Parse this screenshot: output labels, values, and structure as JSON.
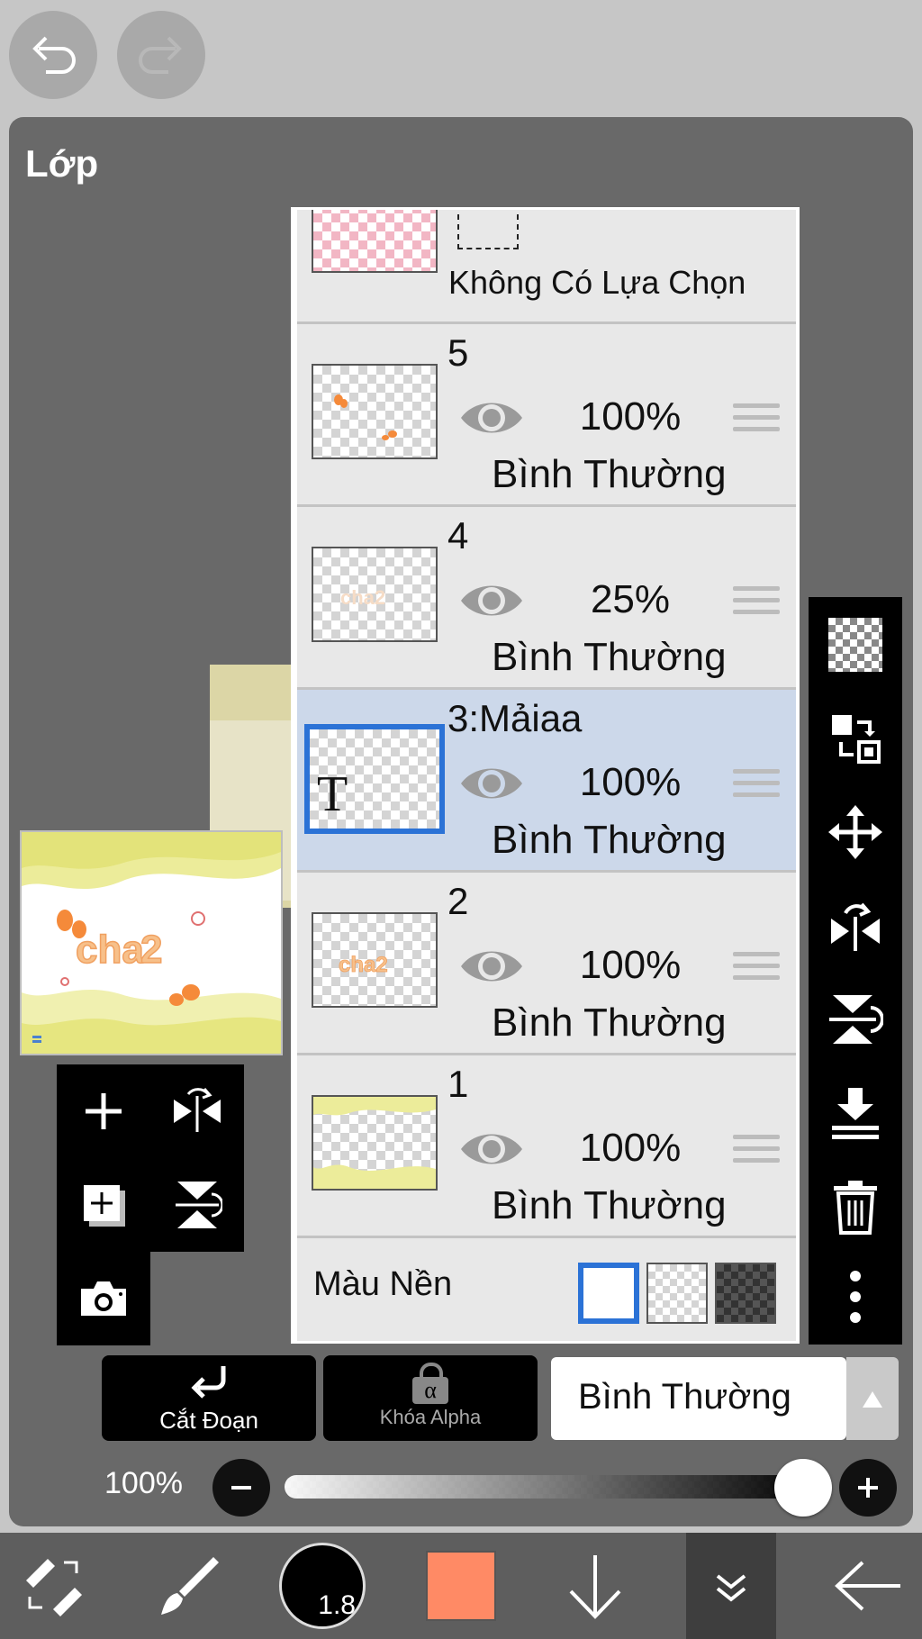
{
  "panel": {
    "title": "Lớp"
  },
  "selection_row": {
    "label": "Không Có Lựa Chọn"
  },
  "layers": [
    {
      "name": "5",
      "opacity": "100%",
      "blend": "Bình Thường",
      "selected": false
    },
    {
      "name": "4",
      "opacity": "25%",
      "blend": "Bình Thường",
      "selected": false
    },
    {
      "name": "3:Mảiaa",
      "opacity": "100%",
      "blend": "Bình Thường",
      "selected": true
    },
    {
      "name": "2",
      "opacity": "100%",
      "blend": "Bình Thường",
      "selected": false
    },
    {
      "name": "1",
      "opacity": "100%",
      "blend": "Bình Thường",
      "selected": false
    }
  ],
  "text_layer_glyph": "T",
  "background": {
    "label": "Màu Nền"
  },
  "controls": {
    "clipping_label": "Cắt Đoạn",
    "alpha_lock_label": "Khóa Alpha",
    "alpha_glyph": "α",
    "blend_mode": "Bình Thường",
    "opacity_label": "100%",
    "opacity_value": 1.0
  },
  "bottombar": {
    "brush_size": "1.8",
    "color": "#ff8a65"
  },
  "colors": {
    "panel": "#696969",
    "selected_row": "#ccd8ea",
    "accent_blue": "#2b72d6"
  }
}
